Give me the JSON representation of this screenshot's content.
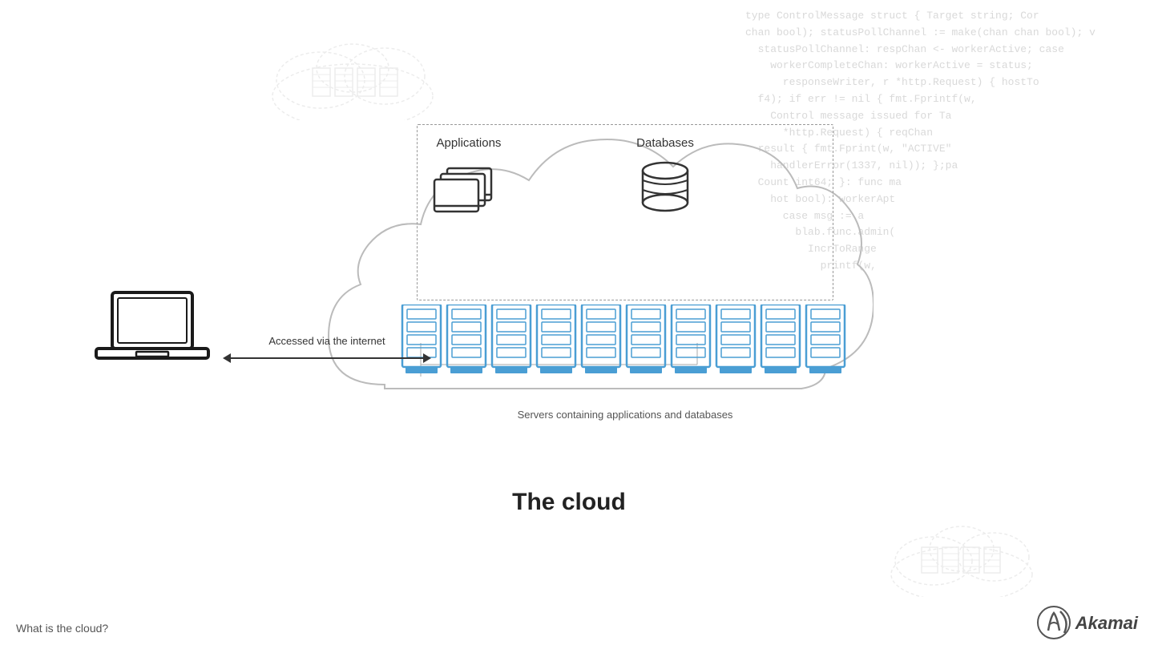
{
  "code_bg": {
    "lines": "type ControlMessage struct { Target string; Cor\nchan bool); statusPollChannel := make(chan chan bool); w\n  statusPollChannel: respChan <- workerActive; case\n    workerCompleteChan: workerActive = status;\n      responseWriter, r *http.Request) { hostTo\n  f4); if err != nil { fmt.Fprintf(w,\n    Control message issued for Ta\n      *http.Request) { reqChan\n  result { fmt.Fprint(w, \"ACTIVE\"\n    handlerError(1337, nil)); };pa\n  Count int64; }: func ma\n    hot bool): workerApt\n      case msg := a\n        blab.func.admin(\n          IncrToRange\n            printf(w,"
  },
  "diagram": {
    "cloud_label": "The cloud",
    "access_label": "Accessed via the internet",
    "apps_label": "Applications",
    "db_label": "Databases",
    "servers_label": "Servers containing applications and databases"
  },
  "footer": {
    "bottom_left": "What is the cloud?",
    "logo_text": "Akamai"
  }
}
